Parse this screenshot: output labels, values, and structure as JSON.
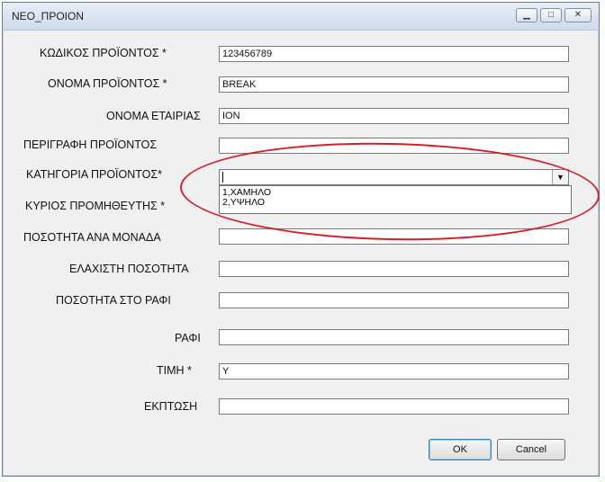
{
  "window": {
    "title": "ΝΕΟ_ΠΡΟΙΟΝ",
    "minimize_icon": "minimize-icon",
    "maximize_icon": "maximize-icon",
    "close_icon": "close-icon"
  },
  "form": {
    "code_label": "ΚΩΔΙΚΟΣ ΠΡΟΪΟΝΤΟΣ *",
    "code_value": "123456789",
    "name_label": "ΟΝΟΜΑ ΠΡΟΪΟΝΤΟΣ *",
    "name_value": "BREAK",
    "company_label": "ΟΝΟΜΑ ΕΤΑΙΡΙΑΣ",
    "company_value": "ΙΟΝ",
    "description_label": "ΠΕΡΙΓΡΑΦΗ ΠΡΟΪΟΝΤΟΣ",
    "description_value": "",
    "category_label": "ΚΑΤΗΓΟΡΙΑ ΠΡΟΪΟΝΤΟΣ*",
    "category_value": "",
    "category_options": [
      "1,ΧΑΜΗΛΟ",
      "2,ΥΨΗΛΟ"
    ],
    "supplier_label": "ΚΥΡΙΟΣ ΠΡΟΜΗΘΕΥΤΗΣ *",
    "supplier_value": "",
    "qty_per_unit_label": "ΠΟΣΟΤΗΤΑ ΑΝΑ ΜΟΝΑΔΑ",
    "qty_per_unit_value": "",
    "min_qty_label": "ΕΛΑΧΙΣΤΗ ΠΟΣΟΤΗΤΑ",
    "min_qty_value": "",
    "shelf_qty_label": "ΠΟΣΟΤΗΤΑ ΣΤΟ ΡΑΦΙ",
    "shelf_qty_value": "",
    "shelf_label": "ΡΑΦΙ",
    "shelf_value": "",
    "price_label": "ΤΙΜΗ *",
    "price_value": "Y",
    "discount_label": "ΕΚΠΤΩΣΗ",
    "discount_value": ""
  },
  "buttons": {
    "ok": "OK",
    "cancel": "Cancel"
  },
  "colors": {
    "highlight_ellipse": "#d3202a"
  }
}
